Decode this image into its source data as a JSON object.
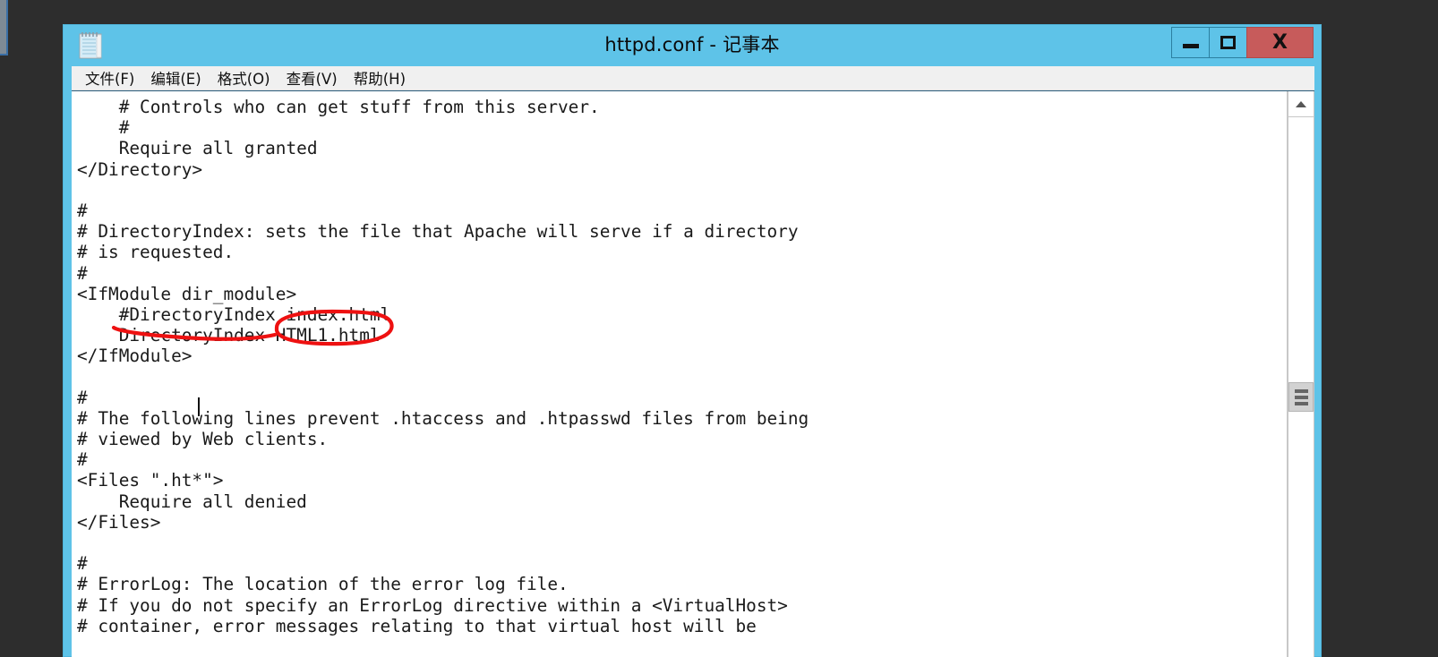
{
  "window": {
    "title": "httpd.conf - 记事本",
    "icon": "notepad-icon",
    "controls": {
      "minimize": "–",
      "maximize": "□",
      "close": "X"
    }
  },
  "menu": {
    "items": [
      {
        "label": "文件(F)"
      },
      {
        "label": "编辑(E)"
      },
      {
        "label": "格式(O)"
      },
      {
        "label": "查看(V)"
      },
      {
        "label": "帮助(H)"
      }
    ]
  },
  "editor": {
    "lines": [
      "    # Controls who can get stuff from this server.",
      "    #",
      "    Require all granted",
      "</Directory>",
      "",
      "#",
      "# DirectoryIndex: sets the file that Apache will serve if a directory",
      "# is requested.",
      "#",
      "<IfModule dir_module>",
      "    #DirectoryIndex index.html",
      "    DirectoryIndex HTML1.html",
      "</IfModule>",
      "",
      "#",
      "# The following lines prevent .htaccess and .htpasswd files from being",
      "# viewed by Web clients.",
      "#",
      "<Files \".ht*\">",
      "    Require all denied",
      "</Files>",
      "",
      "#",
      "# ErrorLog: The location of the error log file.",
      "# If you do not specify an ErrorLog directive within a <VirtualHost>",
      "# container, error messages relating to that virtual host will be"
    ]
  },
  "annotation": {
    "circled_text": "HTML1.html",
    "color": "#ee1111"
  },
  "scrollbar": {
    "up_arrow": "scroll-up-arrow",
    "thumb": "scroll-thumb"
  },
  "colors": {
    "titlebar": "#5ec3e8",
    "close_button": "#c75b5b",
    "desktop": "#2d2d2d",
    "menubar": "#f0f0f0",
    "annotation_red": "#ee1111"
  }
}
